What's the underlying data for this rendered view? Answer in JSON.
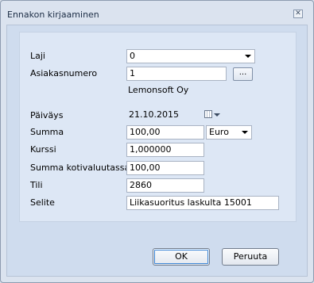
{
  "window": {
    "title": "Ennakon kirjaaminen",
    "close_glyph": "✕"
  },
  "form": {
    "laji": {
      "label": "Laji",
      "value": "0"
    },
    "asiakasnumero": {
      "label": "Asiakasnumero",
      "value": "1",
      "browse_label": "...",
      "customer_name": "Lemonsoft Oy"
    },
    "paivays": {
      "label": "Päiväys",
      "value": "21.10.2015"
    },
    "summa": {
      "label": "Summa",
      "value": "100,00",
      "currency": "Euro"
    },
    "kurssi": {
      "label": "Kurssi",
      "value": "1,000000"
    },
    "summa_koti": {
      "label": "Summa kotivaluutassa",
      "value": "100,00"
    },
    "tili": {
      "label": "Tili",
      "value": "2860"
    },
    "selite": {
      "label": "Selite",
      "value": "Liikasuoritus laskulta 15001"
    }
  },
  "buttons": {
    "ok": "OK",
    "cancel": "Peruuta"
  },
  "icons": {
    "close": "close-icon",
    "calendar": "calendar-icon",
    "dropdown": "chevron-down-icon"
  }
}
